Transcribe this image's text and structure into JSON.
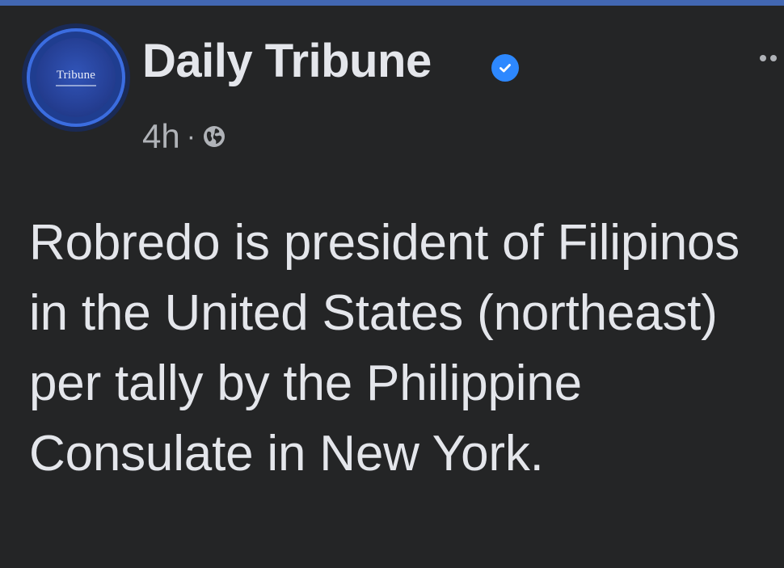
{
  "post": {
    "page_name": "Daily Tribune",
    "avatar_text": "Tribune",
    "timestamp": "4h",
    "separator": "·",
    "privacy_icon": "globe-icon",
    "verified_icon": "verified-badge-icon",
    "more_icon": "more-options-icon",
    "text": "Robredo is president of Filipinos in the United States (northeast) per tally by the Philippine Consulate in New York."
  },
  "colors": {
    "background": "#242526",
    "accent_strip": "#4267b2",
    "verified": "#2d88ff",
    "primary_text": "#e4e6eb",
    "secondary_text": "#b0b3b8"
  }
}
